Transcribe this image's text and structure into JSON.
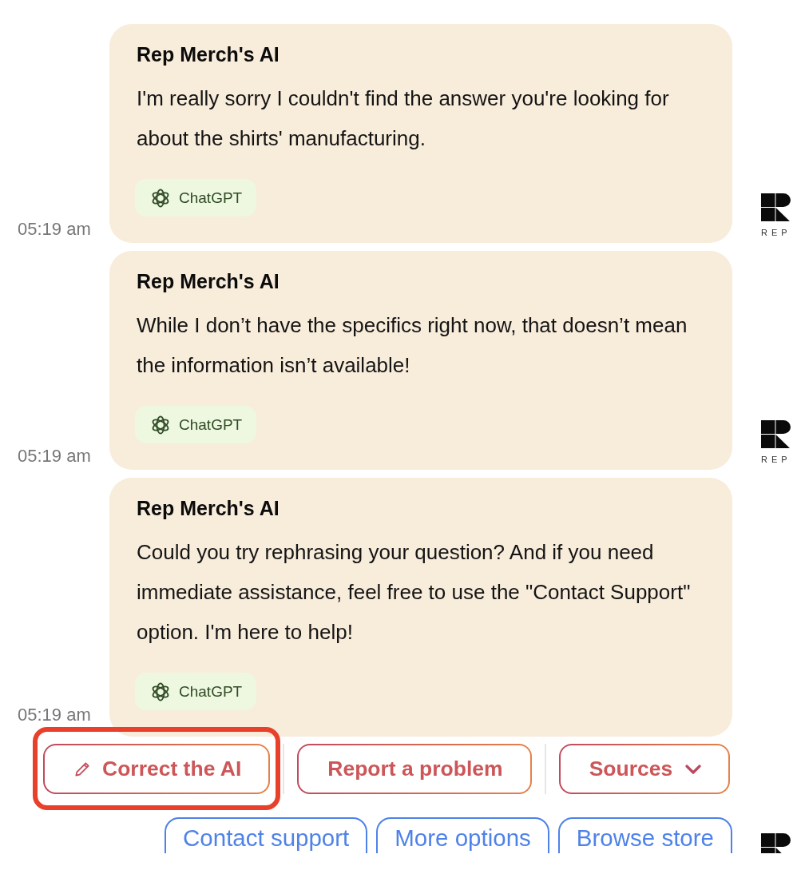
{
  "messages": [
    {
      "sender": "Rep Merch's AI",
      "text": "I'm really sorry I couldn't find the answer you're looking for about the shirts' manufacturing.",
      "source": "ChatGPT",
      "time": "05:19 am",
      "logo": {
        "label": "REP"
      }
    },
    {
      "sender": "Rep Merch's AI",
      "text": "While I don’t have the specifics right now, that doesn’t mean the information isn’t available!",
      "source": "ChatGPT",
      "time": "05:19 am",
      "logo": {
        "label": "REP"
      }
    },
    {
      "sender": "Rep Merch's AI",
      "text": "Could you try rephrasing your question? And if you need immediate assistance, feel free to use the \"Contact Support\" option. I'm here to help!",
      "source": "ChatGPT",
      "time": "05:19 am"
    }
  ],
  "actions": [
    {
      "label": "Correct the AI",
      "kind": "edit",
      "highlighted": true
    },
    {
      "label": "Report a problem",
      "kind": "plain",
      "highlighted": false
    },
    {
      "label": "Sources",
      "kind": "dropdown",
      "highlighted": false
    }
  ],
  "quick_replies": {
    "buttons": [
      "Contact support",
      "More options",
      "Browse store"
    ],
    "show_logo": true
  }
}
